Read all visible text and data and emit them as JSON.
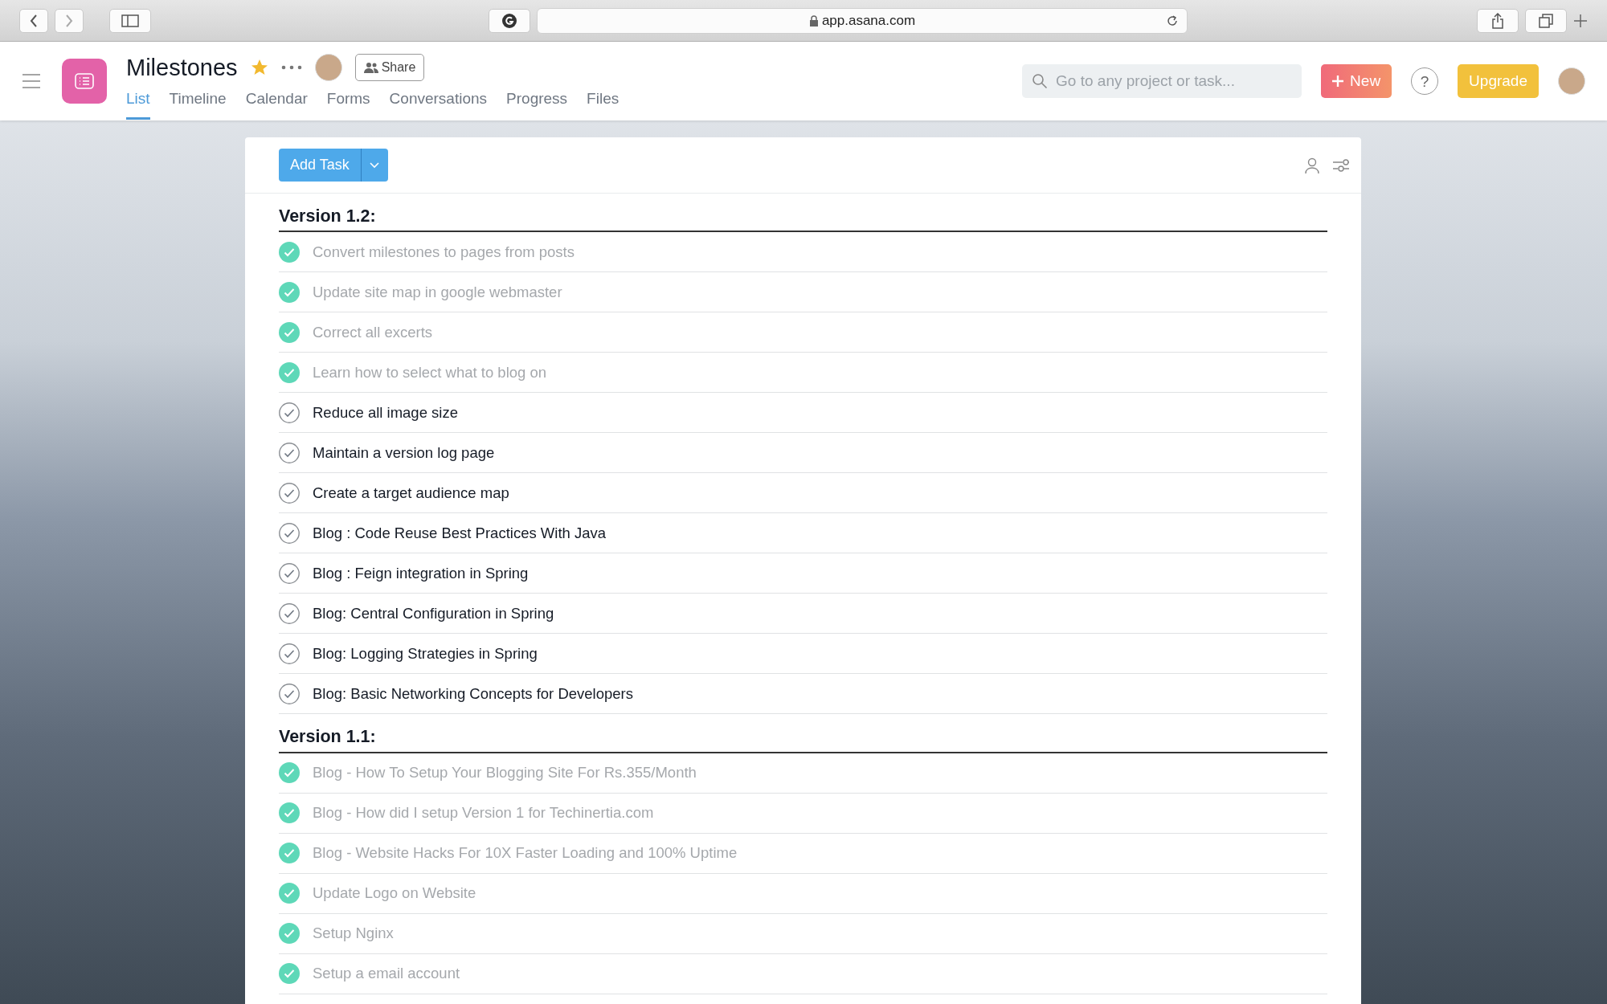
{
  "browser": {
    "url": "app.asana.com"
  },
  "header": {
    "title": "Milestones",
    "starred": true,
    "share_label": "Share",
    "tabs": [
      {
        "label": "List",
        "selected": true
      },
      {
        "label": "Timeline",
        "selected": false
      },
      {
        "label": "Calendar",
        "selected": false
      },
      {
        "label": "Forms",
        "selected": false
      },
      {
        "label": "Conversations",
        "selected": false
      },
      {
        "label": "Progress",
        "selected": false
      },
      {
        "label": "Files",
        "selected": false
      }
    ],
    "search": {
      "placeholder": "Go to any project or task..."
    },
    "new_button": "New",
    "help_button": "?",
    "upgrade_button": "Upgrade"
  },
  "toolbar": {
    "add_task": "Add Task"
  },
  "sections": [
    {
      "title": "Version 1.2:",
      "tasks": [
        {
          "name": "Convert milestones to pages from posts",
          "completed": true
        },
        {
          "name": "Update site map in google webmaster",
          "completed": true
        },
        {
          "name": "Correct all excerts",
          "completed": true
        },
        {
          "name": "Learn how to select what to blog on",
          "completed": true
        },
        {
          "name": "Reduce all image size",
          "completed": false
        },
        {
          "name": "Maintain a version log page",
          "completed": false
        },
        {
          "name": "Create a target audience map",
          "completed": false
        },
        {
          "name": "Blog : Code Reuse Best Practices With Java",
          "completed": false
        },
        {
          "name": "Blog : Feign integration in Spring",
          "completed": false
        },
        {
          "name": "Blog: Central Configuration in Spring",
          "completed": false
        },
        {
          "name": "Blog: Logging Strategies in Spring",
          "completed": false
        },
        {
          "name": "Blog: Basic Networking Concepts for Developers",
          "completed": false
        }
      ]
    },
    {
      "title": "Version 1.1:",
      "tasks": [
        {
          "name": "Blog - How To Setup Your Blogging Site For Rs.355/Month",
          "completed": true
        },
        {
          "name": "Blog - How did I setup Version 1 for Techinertia.com",
          "completed": true
        },
        {
          "name": "Blog - Website Hacks For 10X Faster Loading and 100% Uptime",
          "completed": true
        },
        {
          "name": "Update Logo on Website",
          "completed": true
        },
        {
          "name": "Setup Nginx",
          "completed": true
        },
        {
          "name": "Setup a email account",
          "completed": true
        }
      ]
    }
  ]
}
